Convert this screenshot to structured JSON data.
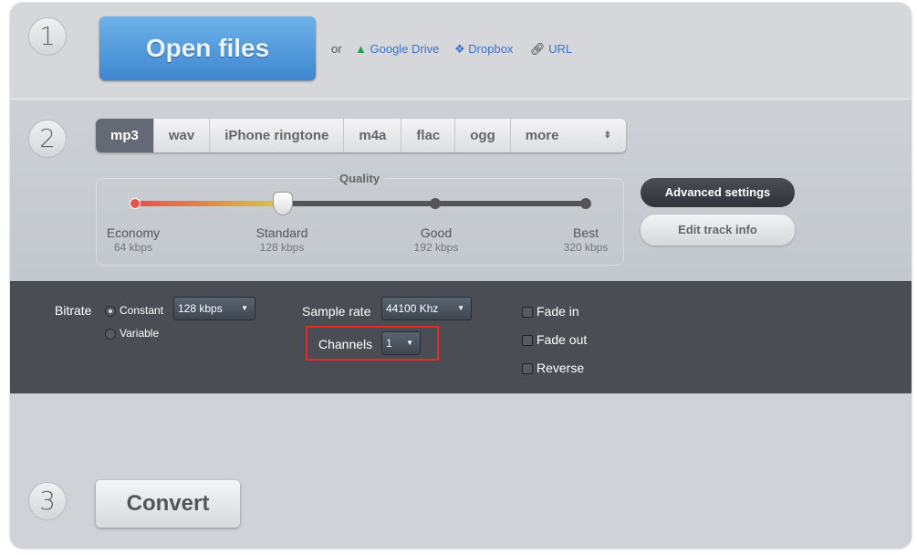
{
  "steps": [
    "1",
    "2",
    "3"
  ],
  "open": {
    "button": "Open files",
    "or": "or",
    "google_drive": "Google Drive",
    "dropbox": "Dropbox",
    "url": "URL"
  },
  "formats": {
    "tabs": [
      "mp3",
      "wav",
      "iPhone ringtone",
      "m4a",
      "flac",
      "ogg",
      "more"
    ],
    "selected": "mp3"
  },
  "quality": {
    "title": "Quality",
    "selected_index": 1,
    "levels": [
      {
        "name": "Economy",
        "rate": "64 kbps"
      },
      {
        "name": "Standard",
        "rate": "128 kbps"
      },
      {
        "name": "Good",
        "rate": "192 kbps"
      },
      {
        "name": "Best",
        "rate": "320 kbps"
      }
    ]
  },
  "buttons": {
    "advanced": "Advanced settings",
    "edit_track": "Edit track info",
    "convert": "Convert"
  },
  "advanced": {
    "bitrate_label": "Bitrate",
    "constant": "Constant",
    "variable": "Variable",
    "bitrate_mode": "Constant",
    "bitrate_value": "128 kbps",
    "sample_rate_label": "Sample rate",
    "sample_rate_value": "44100 Khz",
    "channels_label": "Channels",
    "channels_value": "1",
    "fade_in": "Fade in",
    "fade_out": "Fade out",
    "reverse": "Reverse",
    "fade_in_checked": false,
    "fade_out_checked": false,
    "reverse_checked": false
  },
  "colors": {
    "accent_blue": "#4a90d9",
    "highlight": "#e42a22",
    "dark_panel": "#4a4d53"
  }
}
